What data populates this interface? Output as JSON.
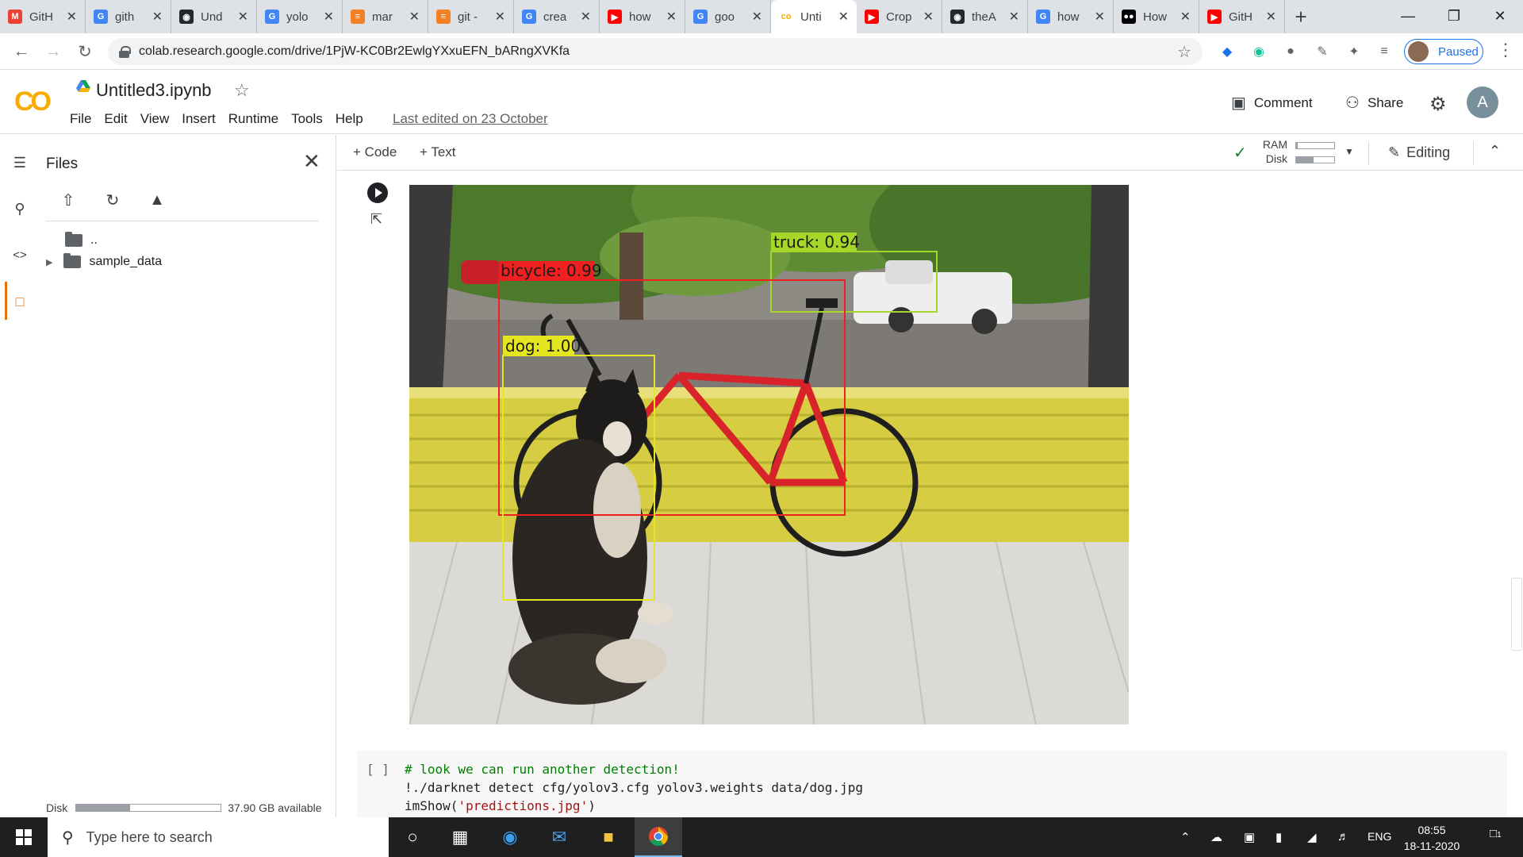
{
  "browser": {
    "tabs": [
      {
        "title": "GitH",
        "favicon": "gmail-icon",
        "color": "#ea4335",
        "glyph": "M"
      },
      {
        "title": "gith",
        "favicon": "google-icon",
        "color": "#4285f4",
        "glyph": "G"
      },
      {
        "title": "Und",
        "favicon": "github-icon",
        "color": "#24292e",
        "glyph": "◉"
      },
      {
        "title": "yolo",
        "favicon": "google-icon",
        "color": "#4285f4",
        "glyph": "G"
      },
      {
        "title": "mar",
        "favicon": "stackoverflow-icon",
        "color": "#f48024",
        "glyph": "≡"
      },
      {
        "title": "git -",
        "favicon": "stackoverflow-icon",
        "color": "#f48024",
        "glyph": "≡"
      },
      {
        "title": "crea",
        "favicon": "google-icon",
        "color": "#4285f4",
        "glyph": "G"
      },
      {
        "title": "how",
        "favicon": "youtube-icon",
        "color": "#ff0000",
        "glyph": "▶"
      },
      {
        "title": "goo",
        "favicon": "google-icon",
        "color": "#4285f4",
        "glyph": "G"
      },
      {
        "title": "Unti",
        "favicon": "colab-icon",
        "color": "#f9ab00",
        "glyph": "co"
      },
      {
        "title": "Crop",
        "favicon": "youtube-icon",
        "color": "#ff0000",
        "glyph": "▶"
      },
      {
        "title": "theA",
        "favicon": "github-icon",
        "color": "#24292e",
        "glyph": "◉"
      },
      {
        "title": "how",
        "favicon": "google-icon",
        "color": "#4285f4",
        "glyph": "G"
      },
      {
        "title": "How",
        "favicon": "medium-icon",
        "color": "#000000",
        "glyph": "●●"
      },
      {
        "title": "GitH",
        "favicon": "youtube-icon",
        "color": "#ff0000",
        "glyph": "▶"
      }
    ],
    "active_tab": 9,
    "url": "colab.research.google.com/drive/1PjW-KC0Br2EwlgYXxuEFN_bARngXVKfa",
    "profile_status": "Paused"
  },
  "colab": {
    "logo": "CO",
    "notebook_title": "Untitled3.ipynb",
    "menu": [
      "File",
      "Edit",
      "View",
      "Insert",
      "Runtime",
      "Tools",
      "Help"
    ],
    "last_edited": "Last edited on 23 October",
    "comment_label": "Comment",
    "share_label": "Share",
    "user_initial": "A"
  },
  "files_panel": {
    "title": "Files",
    "parent_dir": "..",
    "folders": [
      "sample_data"
    ],
    "disk_label": "Disk",
    "disk_available": "37.90 GB available",
    "disk_used_fraction": 0.37
  },
  "toolbar": {
    "add_code": "+ Code",
    "add_text": "+ Text",
    "ram_label": "RAM",
    "disk_label": "Disk",
    "ram_used_fraction": 0.05,
    "disk_used_fraction": 0.45,
    "mode": "Editing"
  },
  "output_image": {
    "detections": [
      {
        "label": "truck: 0.94",
        "color": "#a6d62a"
      },
      {
        "label": "bicycle: 0.99",
        "color": "#f02020"
      },
      {
        "label": "dog: 1.00",
        "color": "#e6e620"
      }
    ]
  },
  "code_cell": {
    "bracket": "[ ]",
    "comment": "# look we can run another detection!",
    "line2": "!./darknet detect cfg/yolov3.cfg yolov3.weights data/dog.jpg",
    "line3_fn": "imShow(",
    "line3_str": "'predictions.jpg'",
    "line3_end": ")"
  },
  "taskbar": {
    "search_placeholder": "Type here to search",
    "language": "ENG",
    "time": "08:55",
    "date": "18-11-2020",
    "notification_count": "1"
  }
}
